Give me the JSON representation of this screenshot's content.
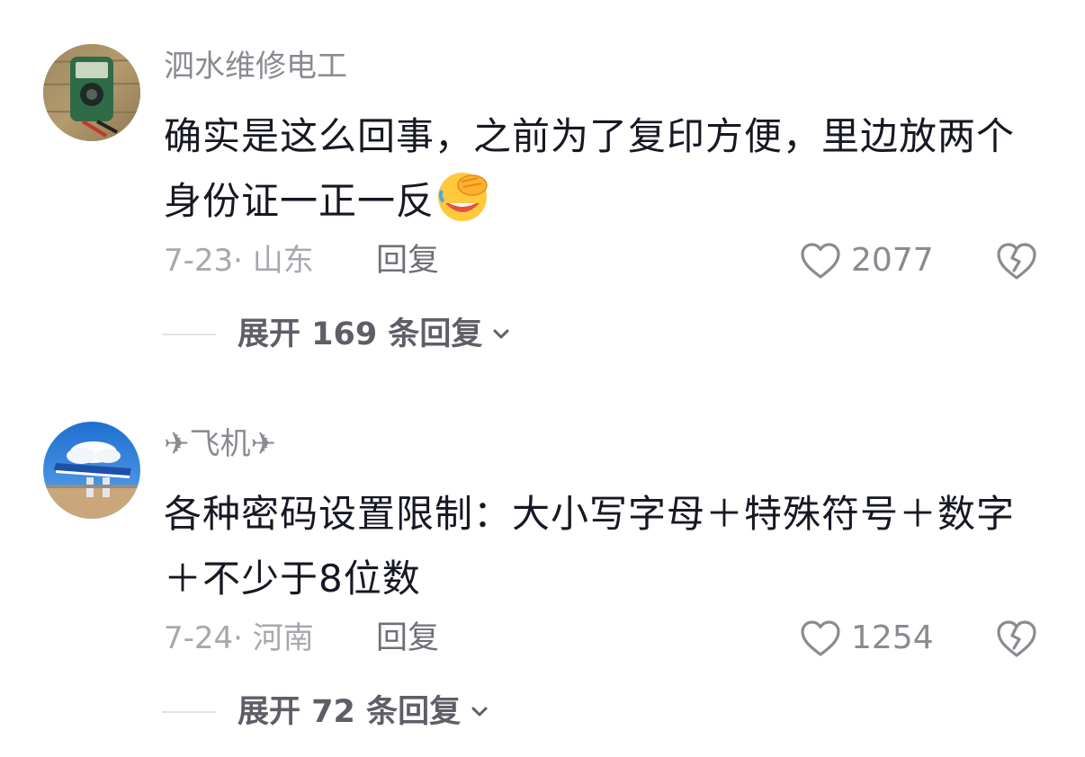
{
  "comments": [
    {
      "username": "泗水维修电工",
      "content_line1": "确实是这么回事，之前为了复印方便，里边放两个",
      "content_line2": "身份证一正一反",
      "emoji": "facepalm-laugh-emoji",
      "date_location": "7-23· 山东",
      "reply_label": "回复",
      "like_count": "2077",
      "expand_label": "展开 169 条回复"
    },
    {
      "username": "✈飞机✈",
      "content_line1": "各种密码设置限制：大小写字母＋特殊符号＋数字",
      "content_line2": "＋不少于8位数",
      "date_location": "7-24· 河南",
      "reply_label": "回复",
      "like_count": "1254",
      "expand_label": "展开 72 条回复"
    }
  ],
  "icons": {
    "like": "heart-outline-icon",
    "dislike": "broken-heart-icon",
    "expand": "chevron-down-icon"
  },
  "colors": {
    "text_primary": "#161823",
    "text_secondary": "#8a8b91",
    "text_muted": "#a7a8ad",
    "icon_gray": "#8a8b91"
  }
}
